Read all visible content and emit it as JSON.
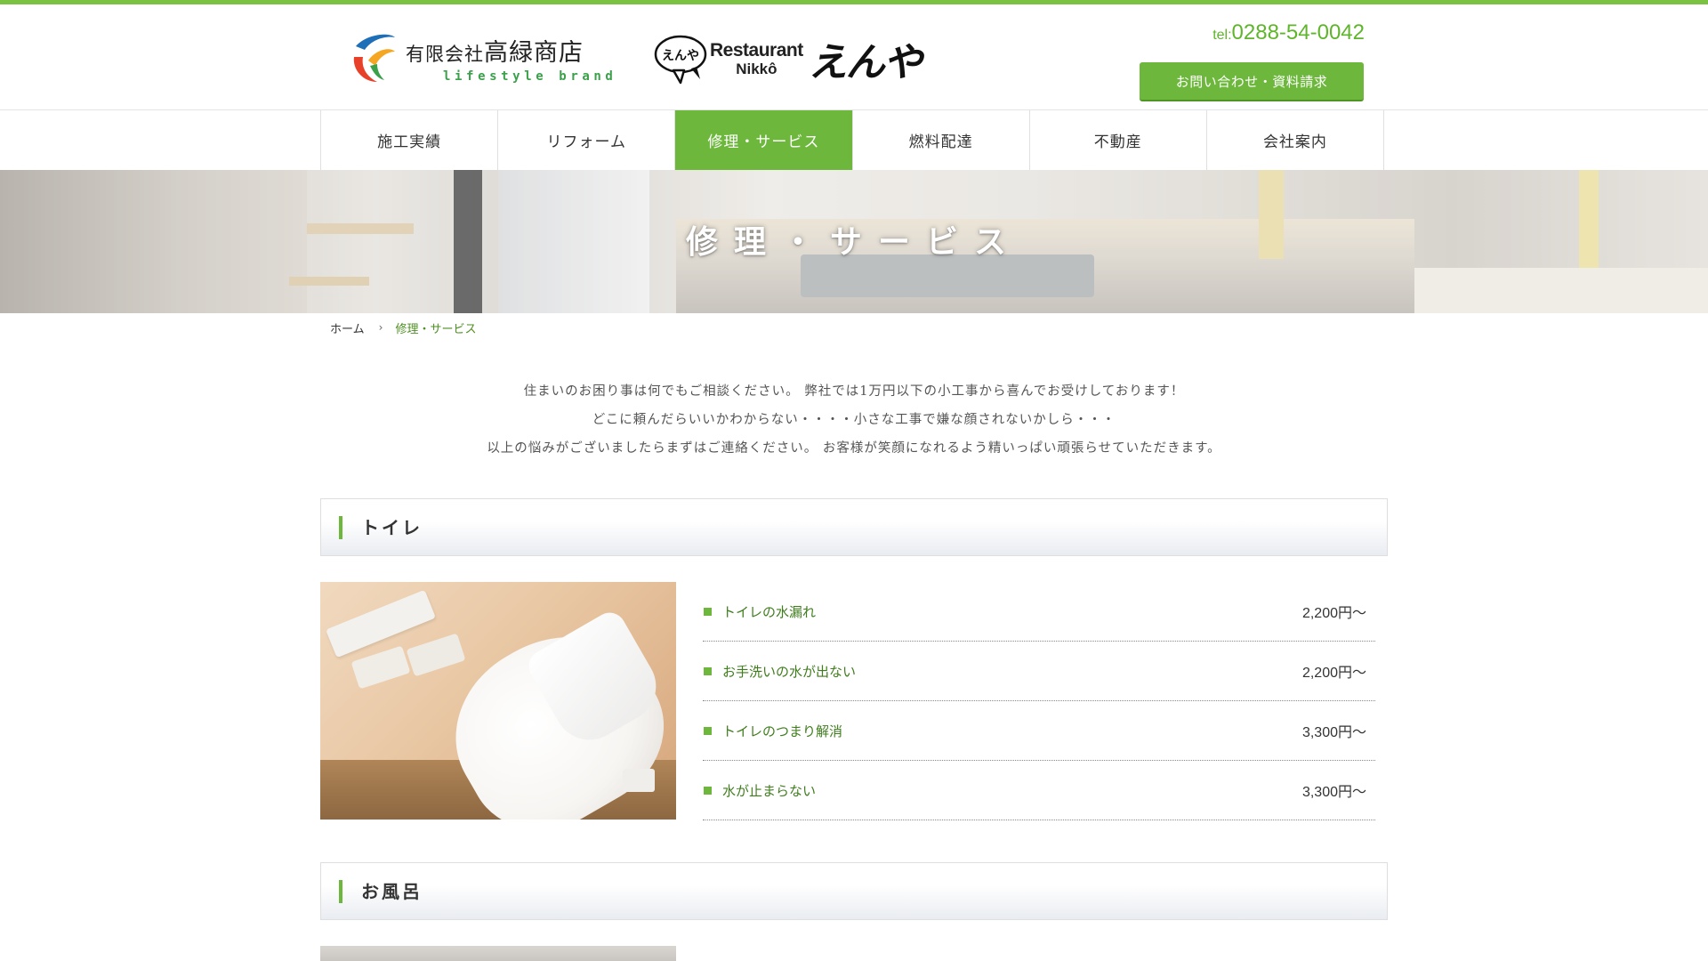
{
  "header": {
    "company_logo": {
      "name_prefix": "有限会社",
      "name_main": "高緑商店",
      "tagline": "lifestyle brand"
    },
    "restaurant_logo": {
      "badge_text": "えんや",
      "line1": "Restaurant",
      "line2": "Nikkô",
      "name": "えんや"
    },
    "tel_label": "tel:",
    "tel_number": "0288-54-0042",
    "contact_button": "お問い合わせ・資料請求"
  },
  "nav": {
    "items": [
      {
        "label": "施工実績"
      },
      {
        "label": "リフォーム"
      },
      {
        "label": "修理・サービス"
      },
      {
        "label": "燃料配達"
      },
      {
        "label": "不動産"
      },
      {
        "label": "会社案内"
      }
    ],
    "active_index": 2
  },
  "hero": {
    "title": "修理・サービス"
  },
  "breadcrumb": {
    "home": "ホーム",
    "separator": "›",
    "current": "修理・サービス"
  },
  "intro": {
    "lines": [
      "住まいのお困り事は何でもご相談ください。 弊社では1万円以下の小工事から喜んでお受けしております！",
      "どこに頼んだらいいかわからない・・・・小さな工事で嫌な顔されないかしら・・・",
      "以上の悩みがございましたらまずはご連絡ください。 お客様が笑顔になれるよう精いっぱい頑張らせていただきます。"
    ]
  },
  "sections": [
    {
      "title": "トイレ",
      "items": [
        {
          "label": "トイレの水漏れ",
          "price": "2,200円〜"
        },
        {
          "label": "お手洗いの水が出ない",
          "price": "2,200円〜"
        },
        {
          "label": "トイレのつまり解消",
          "price": "3,300円〜"
        },
        {
          "label": "水が止まらない",
          "price": "3,300円〜"
        }
      ]
    },
    {
      "title": "お風呂"
    }
  ],
  "colors": {
    "accent": "#6db83c",
    "accent_text": "#3f7d1c",
    "tel": "#5fb52b"
  }
}
